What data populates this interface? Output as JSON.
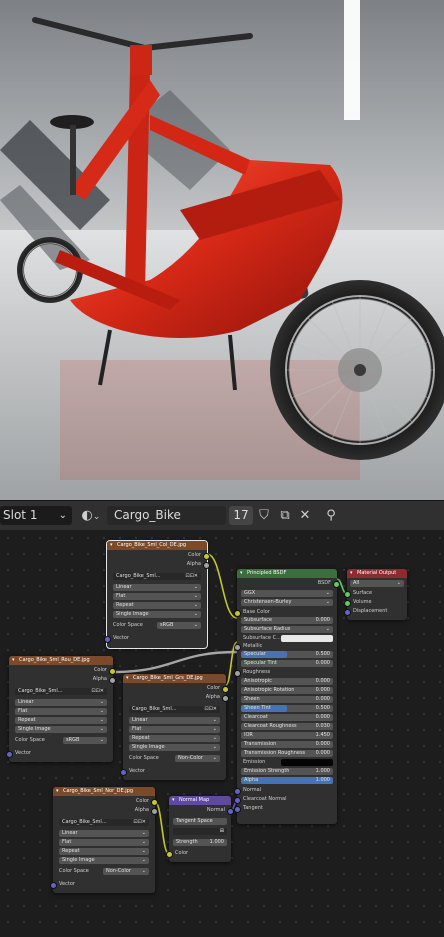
{
  "header": {
    "slot": "Slot 1",
    "material_name": "Cargo_Bike",
    "user_count": "17"
  },
  "nodes": {
    "tex_col": {
      "title": "Cargo_Bike_Sml_Col_DE.jpg",
      "outputs": [
        "Color",
        "Alpha"
      ],
      "image_name": "Cargo_Bike_Sml...",
      "interpolation": "Linear",
      "projection": "Flat",
      "extension": "Repeat",
      "source": "Single Image",
      "color_space_label": "Color Space",
      "color_space_value": "sRGB",
      "input": "Vector"
    },
    "tex_rough": {
      "title": "Cargo_Bike_Sml_Rou_DE.jpg",
      "outputs": [
        "Color",
        "Alpha"
      ],
      "image_name": "Cargo_Bike_Sml...",
      "interpolation": "Linear",
      "projection": "Flat",
      "extension": "Repeat",
      "source": "Single Image",
      "color_space_label": "Color Space",
      "color_space_value": "sRGB",
      "input": "Vector"
    },
    "tex_met": {
      "title": "Cargo_Bike_Sml_Grs_DE.jpg",
      "outputs": [
        "Color",
        "Alpha"
      ],
      "image_name": "Cargo_Bike_Sml...",
      "interpolation": "Linear",
      "projection": "Flat",
      "extension": "Repeat",
      "source": "Single Image",
      "color_space_label": "Color Space",
      "color_space_value": "Non-Color",
      "input": "Vector"
    },
    "tex_nor": {
      "title": "Cargo_Bike_Sml_Nor_DE.jpg",
      "outputs": [
        "Color",
        "Alpha"
      ],
      "image_name": "Cargo_Bike_Sml...",
      "interpolation": "Linear",
      "projection": "Flat",
      "extension": "Repeat",
      "source": "Single Image",
      "color_space_label": "Color Space",
      "color_space_value": "Non-Color",
      "input": "Vector"
    },
    "normal_map": {
      "title": "Normal Map",
      "output": "Normal",
      "space_label": "Tangent Space",
      "uv_value": "",
      "strength_label": "Strength",
      "strength_value": "1.000",
      "input": "Color"
    },
    "bsdf": {
      "title": "Principled BSDF",
      "output": "BSDF",
      "distribution": "GGX",
      "subsurface_method": "Christensen-Burley",
      "base_color": "Base Color",
      "subsurface": {
        "label": "Subsurface",
        "value": "0.000"
      },
      "subsurface_radius": "Subsurface Radius",
      "subsurface_color": "Subsurface C...",
      "metallic": "Metallic",
      "specular": {
        "label": "Specular",
        "value": "0.500"
      },
      "specular_tint": {
        "label": "Specular Tint",
        "value": "0.000"
      },
      "roughness": "Roughness",
      "anisotropic": {
        "label": "Anisotropic",
        "value": "0.000"
      },
      "anisotropic_rotation": {
        "label": "Anisotropic Rotation",
        "value": "0.000"
      },
      "sheen": {
        "label": "Sheen",
        "value": "0.000"
      },
      "sheen_tint": {
        "label": "Sheen Tint",
        "value": "0.500"
      },
      "clearcoat": {
        "label": "Clearcoat",
        "value": "0.000"
      },
      "clearcoat_roughness": {
        "label": "Clearcoat Roughness",
        "value": "0.030"
      },
      "ior": {
        "label": "IOR",
        "value": "1.450"
      },
      "transmission": {
        "label": "Transmission",
        "value": "0.000"
      },
      "transmission_roughness": {
        "label": "Transmission Roughness",
        "value": "0.000"
      },
      "emission": "Emission",
      "emission_strength": {
        "label": "Emission Strength",
        "value": "1.000"
      },
      "alpha": {
        "label": "Alpha",
        "value": "1.000"
      },
      "normal": "Normal",
      "clearcoat_normal": "Clearcoat Normal",
      "tangent": "Tangent"
    },
    "output": {
      "title": "Material Output",
      "target": "All",
      "inputs": [
        "Surface",
        "Volume",
        "Displacement"
      ]
    }
  },
  "fill_levels": {
    "specular": 0.5,
    "sheen_tint": 0.5,
    "alpha": 1.0
  },
  "colors": {
    "bike_frame": "#d02a1c",
    "texture_header": "#7a4a2b",
    "bsdf_header": "#3a6e3c",
    "output_header": "#8c2b31",
    "normal_map_header": "#5e4aa0",
    "slider_fill": "#4772b3"
  },
  "icons": [
    "chevron-down-icon",
    "material-sphere-icon",
    "shield-icon",
    "duplicate-icon",
    "close-icon",
    "pin-icon"
  ]
}
